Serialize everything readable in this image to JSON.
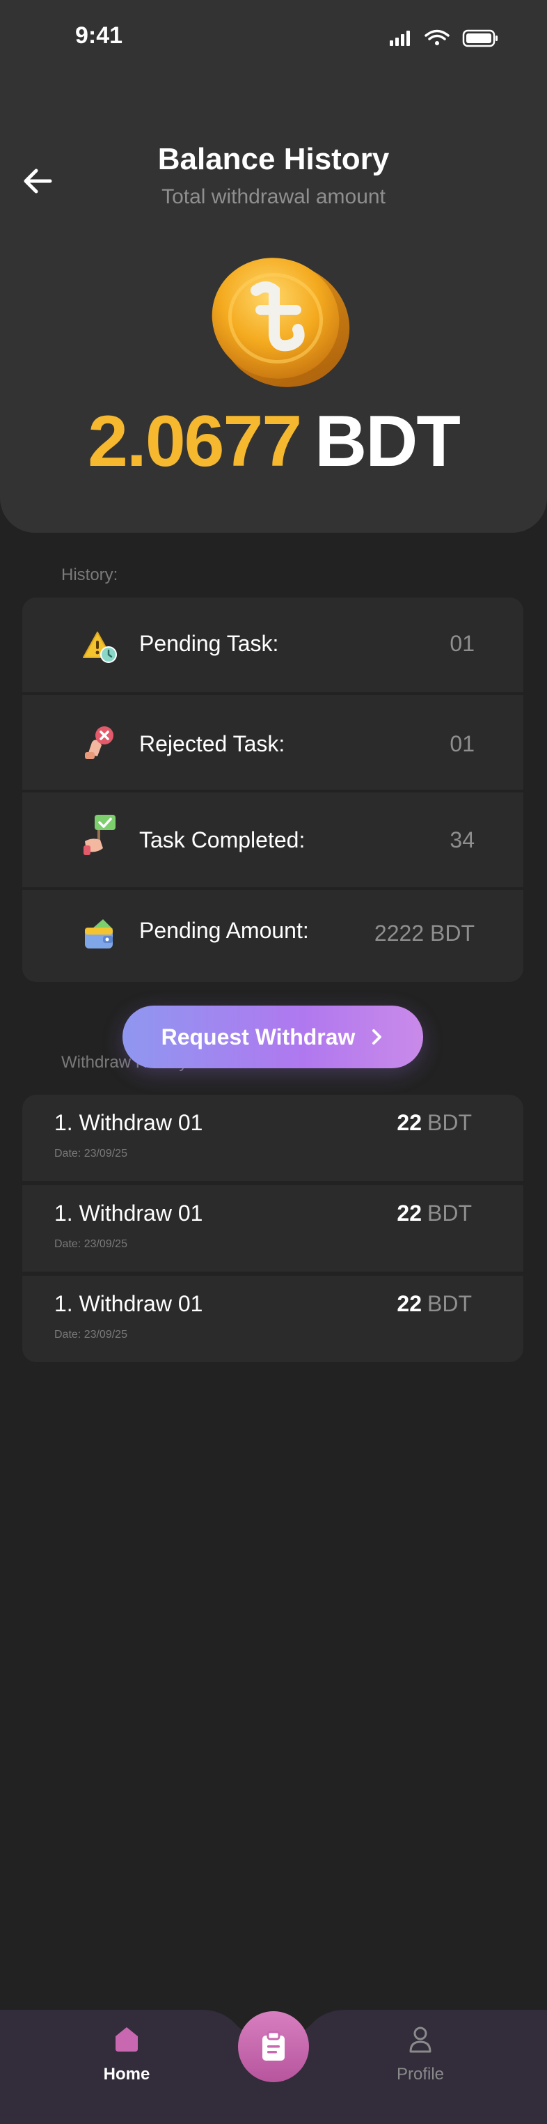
{
  "status_bar": {
    "time": "9:41"
  },
  "header": {
    "title": "Balance History",
    "subtitle": "Total withdrawal amount",
    "amount": "2.0677",
    "currency": "BDT"
  },
  "history": {
    "label": "History:",
    "items": [
      {
        "icon": "warning-clock-icon",
        "label": "Pending Task:",
        "value": "01"
      },
      {
        "icon": "hand-reject-icon",
        "label": "Rejected Task:",
        "value": "01"
      },
      {
        "icon": "hand-check-icon",
        "label": "Task Completed:",
        "value": "34"
      },
      {
        "icon": "wallet-icon",
        "label": "Pending Amount:",
        "value": "2222 BDT"
      }
    ]
  },
  "request_button": {
    "label": "Request Withdraw"
  },
  "withdraw_history": {
    "label": "Withdraw History",
    "items": [
      {
        "title": "1. Withdraw 01",
        "date": "Date: 23/09/25",
        "amount": "22",
        "currency": "BDT"
      },
      {
        "title": "1. Withdraw 01",
        "date": "Date: 23/09/25",
        "amount": "22",
        "currency": "BDT"
      },
      {
        "title": "1. Withdraw 01",
        "date": "Date: 23/09/25",
        "amount": "22",
        "currency": "BDT"
      }
    ]
  },
  "nav": {
    "home": "Home",
    "profile": "Profile"
  },
  "colors": {
    "accent_gold": "#f5b82e",
    "nav_bg": "#322c3b",
    "fab_pink": "#c868b0"
  }
}
